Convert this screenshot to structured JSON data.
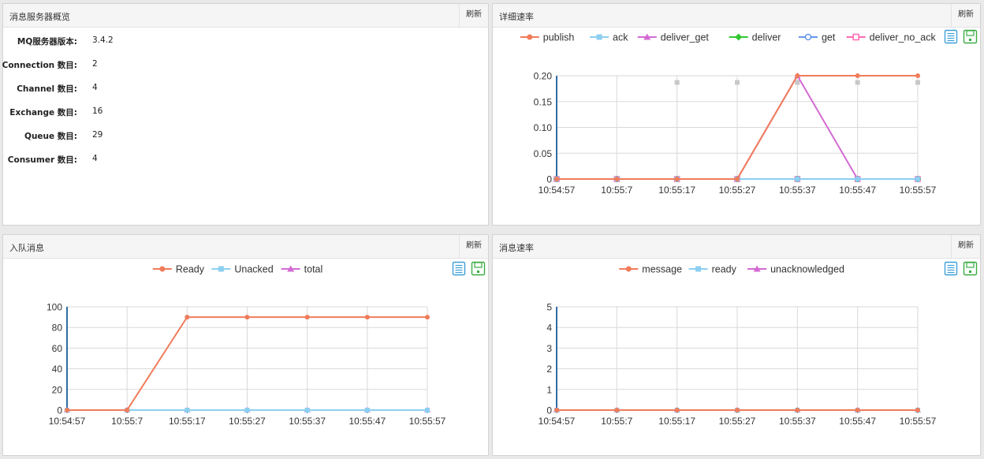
{
  "overview": {
    "title": "消息服务器概览",
    "refresh": "刷新",
    "rows": [
      {
        "label": "MQ服务器版本:",
        "value": "3.4.2"
      },
      {
        "label": "Connection 数目:",
        "value": "2"
      },
      {
        "label": "Channel 数目:",
        "value": "4"
      },
      {
        "label": "Exchange 数目:",
        "value": "16"
      },
      {
        "label": "Queue 数目:",
        "value": "29"
      },
      {
        "label": "Consumer 数目:",
        "value": "4"
      }
    ]
  },
  "rates": {
    "title": "详细速率",
    "refresh": "刷新",
    "toolbar": [
      "data-view-icon",
      "save-image-icon"
    ]
  },
  "queued": {
    "title": "入队消息",
    "refresh": "刷新",
    "toolbar": [
      "data-view-icon",
      "save-image-icon"
    ]
  },
  "msgrates": {
    "title": "消息速率",
    "refresh": "刷新",
    "toolbar": [
      "data-view-icon",
      "save-image-icon"
    ]
  },
  "chart_data": [
    {
      "id": "rates",
      "type": "line",
      "title": "",
      "categories": [
        "10:54:57",
        "10:55:7",
        "10:55:17",
        "10:55:27",
        "10:55:37",
        "10:55:47",
        "10:55:57"
      ],
      "ylim": [
        0,
        0.2
      ],
      "yticks": [
        "0",
        "0.05",
        "0.10",
        "0.15",
        "0.20"
      ],
      "yticks_values": [
        0,
        0.05,
        0.1,
        0.15,
        0.2
      ],
      "series": [
        {
          "name": "publish",
          "color": "#f07c5a",
          "marker": "circle",
          "values": [
            0,
            0,
            0,
            0,
            0.2,
            0.2,
            0.2
          ]
        },
        {
          "name": "ack",
          "color": "#8ccff0",
          "marker": "square",
          "values": [
            0,
            0,
            0,
            0,
            0,
            0,
            0
          ]
        },
        {
          "name": "deliver_get",
          "color": "#d36ad3",
          "marker": "triangle",
          "values": [
            0,
            0,
            0,
            0,
            0.2,
            0,
            0
          ]
        },
        {
          "name": "deliver",
          "color": "#32c832",
          "marker": "diamond",
          "values": [
            0,
            0,
            0,
            0,
            0,
            0,
            0
          ]
        },
        {
          "name": "get",
          "color": "#6495ed",
          "marker": "hollow-circle",
          "values": [
            0,
            0,
            0,
            0,
            0,
            0,
            0
          ]
        },
        {
          "name": "deliver_no_ack",
          "color": "#ff69b4",
          "marker": "hollow-square",
          "values": [
            0,
            0,
            0,
            0,
            0,
            0,
            0
          ]
        }
      ],
      "grey_markers": [
        null,
        null,
        0.187,
        0.187,
        0.187,
        0.187,
        0.187
      ]
    },
    {
      "id": "queued",
      "type": "line",
      "title": "",
      "categories": [
        "10:54:57",
        "10:55:7",
        "10:55:17",
        "10:55:27",
        "10:55:37",
        "10:55:47",
        "10:55:57"
      ],
      "ylim": [
        0,
        100
      ],
      "yticks": [
        "0",
        "20",
        "40",
        "60",
        "80",
        "100"
      ],
      "yticks_values": [
        0,
        20,
        40,
        60,
        80,
        100
      ],
      "series": [
        {
          "name": "Ready",
          "color": "#f07c5a",
          "marker": "circle",
          "values": [
            0,
            0,
            90,
            90,
            90,
            90,
            90
          ]
        },
        {
          "name": "Unacked",
          "color": "#8ccff0",
          "marker": "square",
          "values": [
            0,
            0,
            0,
            0,
            0,
            0,
            0
          ]
        },
        {
          "name": "total",
          "color": "#d36ad3",
          "marker": "triangle",
          "values": [
            0,
            0,
            0,
            0,
            0,
            0,
            0
          ]
        }
      ]
    },
    {
      "id": "msgrates",
      "type": "line",
      "title": "",
      "categories": [
        "10:54:57",
        "10:55:7",
        "10:55:17",
        "10:55:27",
        "10:55:37",
        "10:55:47",
        "10:55:57"
      ],
      "ylim": [
        0,
        5
      ],
      "yticks": [
        "0",
        "1",
        "2",
        "3",
        "4",
        "5"
      ],
      "yticks_values": [
        0,
        1,
        2,
        3,
        4,
        5
      ],
      "series": [
        {
          "name": "message",
          "color": "#f07c5a",
          "marker": "circle",
          "values": [
            0,
            0,
            0,
            0,
            0,
            0,
            0
          ]
        },
        {
          "name": "ready",
          "color": "#8ccff0",
          "marker": "square",
          "values": [
            0,
            0,
            0,
            0,
            0,
            0,
            0
          ]
        },
        {
          "name": "unacknowledged",
          "color": "#d36ad3",
          "marker": "triangle",
          "values": [
            0,
            0,
            0,
            0,
            0,
            0,
            0
          ]
        }
      ]
    }
  ]
}
